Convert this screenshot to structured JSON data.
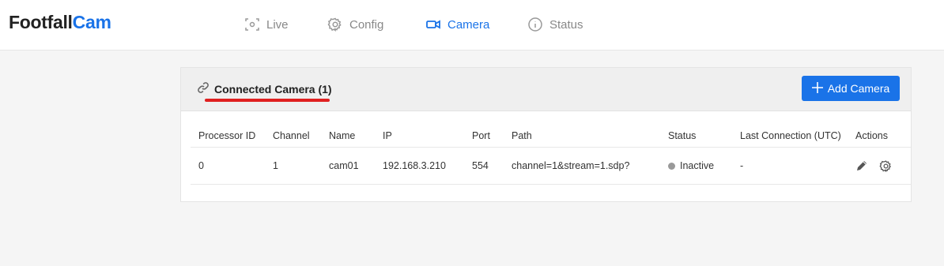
{
  "app": {
    "logo_part1": "Footfall",
    "logo_part2": "Cam"
  },
  "nav": [
    {
      "label": "Live",
      "icon": "live-view-icon",
      "active": false
    },
    {
      "label": "Config",
      "icon": "gear-icon",
      "active": false
    },
    {
      "label": "Camera",
      "icon": "video-camera-icon",
      "active": true
    },
    {
      "label": "Status",
      "icon": "info-icon",
      "active": false
    }
  ],
  "panel": {
    "title": "Connected Camera (1)",
    "title_icon": "link-icon",
    "add_button": "Add Camera"
  },
  "table": {
    "headers": [
      "Processor ID",
      "Channel",
      "Name",
      "IP",
      "Port",
      "Path",
      "Status",
      "Last Connection (UTC)",
      "Actions"
    ],
    "rows": [
      {
        "processor_id": "0",
        "channel": "1",
        "name": "cam01",
        "ip": "192.168.3.210",
        "port": "554",
        "path": "channel=1&stream=1.sdp?",
        "status": "Inactive",
        "last_connection": "-"
      }
    ]
  },
  "colors": {
    "accent": "#1a73e8",
    "annotation": "#e02020",
    "inactive": "#999999"
  }
}
